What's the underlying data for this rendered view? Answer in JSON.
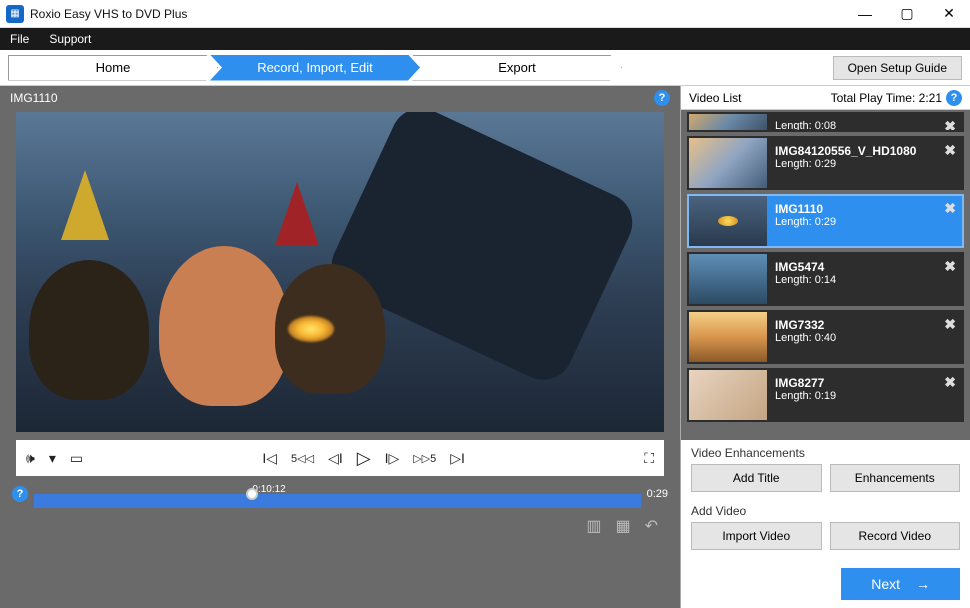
{
  "window": {
    "title": "Roxio Easy VHS to DVD Plus"
  },
  "menu": {
    "file": "File",
    "support": "Support"
  },
  "nav": {
    "home": "Home",
    "record": "Record, Import, Edit",
    "export": "Export",
    "setup": "Open Setup Guide"
  },
  "preview": {
    "name": "IMG1110"
  },
  "timeline": {
    "pos": "0:10:12",
    "end": "0:29"
  },
  "list": {
    "header": "Video List",
    "total_label": "Total Play Time:",
    "total_time": "2:21",
    "items": [
      {
        "name": "",
        "len": "Length: 0:08",
        "partial": true,
        "thumb": "t1"
      },
      {
        "name": "IMG84120556_V_HD1080",
        "len": "Length: 0:29",
        "thumb": "t2"
      },
      {
        "name": "IMG1110",
        "len": "Length: 0:29",
        "sel": true,
        "thumb": "t3"
      },
      {
        "name": "IMG5474",
        "len": "Length: 0:14",
        "thumb": "t4"
      },
      {
        "name": "IMG7332",
        "len": "Length: 0:40",
        "thumb": "t5"
      },
      {
        "name": "IMG8277",
        "len": "Length: 0:19",
        "thumb": "t6"
      }
    ]
  },
  "enh": {
    "label": "Video Enhancements",
    "add_title": "Add Title",
    "enhancements": "Enhancements"
  },
  "addv": {
    "label": "Add Video",
    "import": "Import Video",
    "record": "Record Video"
  },
  "next": "Next"
}
